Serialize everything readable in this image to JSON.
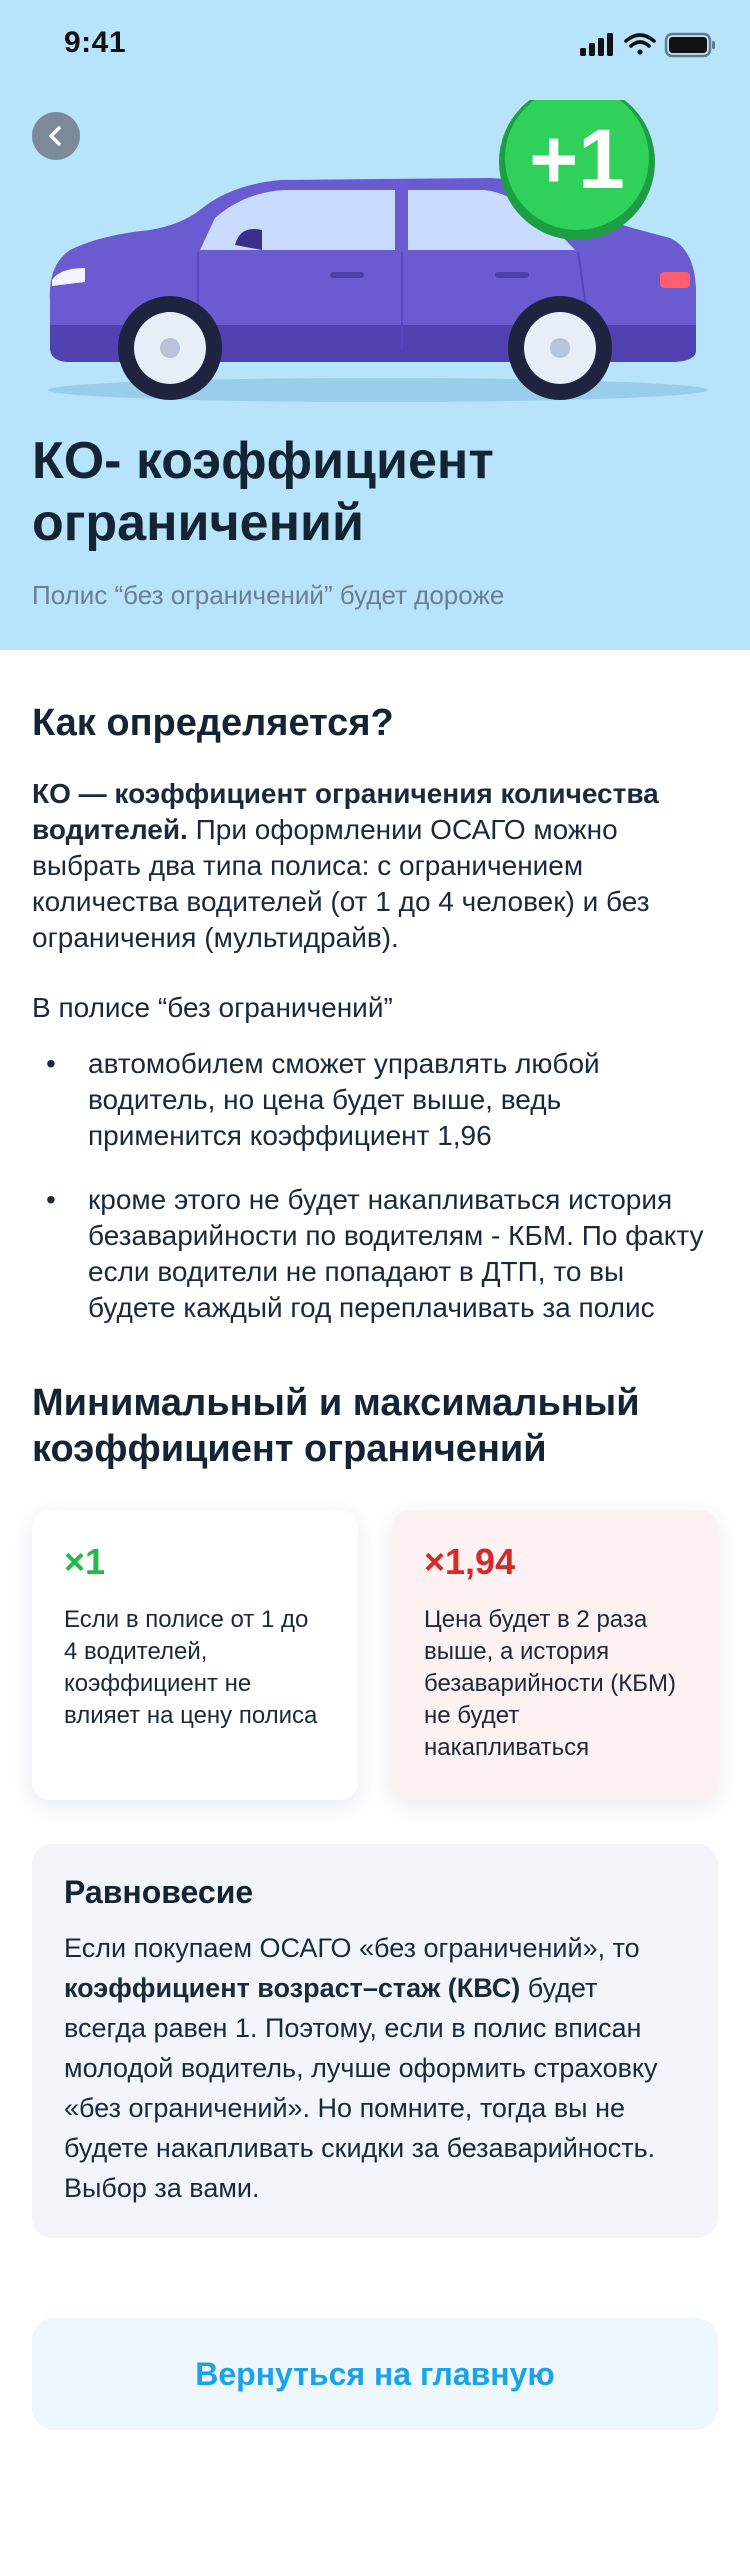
{
  "status_bar": {
    "time": "9:41"
  },
  "hero": {
    "back_icon": "chevron-left-icon",
    "badge_text": "+1",
    "title": "КО- коэффициент ограничений",
    "subtitle": "Полис “без ограничений” будет дороже",
    "colors": {
      "background": "#b7e4fa",
      "car": "#6a5bd0",
      "badge": "#2fd15a"
    }
  },
  "section1": {
    "title": "Как определяется?",
    "intro_bold": "КО — коэффициент ограничения количества водителей.",
    "intro_rest": " При оформлении ОСАГО можно выбрать два типа полиса: с ограничением количества водителей (от 1 до 4 человек) и без ограничения (мультидрайв).",
    "policy_label": "В полисе “без ограничений”",
    "bullets": [
      "автомобилем сможет управлять любой водитель, но цена будет выше, ведь применится коэффициент 1,96",
      "кроме этого не будет накапливаться история безаварийности по водителям - КБМ. По факту если водители не попадают в ДТП, то вы будете каждый год переплачивать за полис"
    ]
  },
  "section2": {
    "title": "Минимальный и максимальный коэффициент ограничений",
    "cards": [
      {
        "value": "×1",
        "text": "Если в полисе от 1 до 4 водителей, коэффициент не влияет на цену полиса",
        "color": "#22b84a"
      },
      {
        "value": "×1,94",
        "text": "Цена будет в 2 раза выше, а история безаварийности (КБМ) не будет накапливаться",
        "color": "#d32a2a"
      }
    ]
  },
  "info": {
    "title": "Равновесие",
    "text_1": "Если покупаем ОСАГО «без ограничений», то ",
    "text_bold": "коэффициент возраст–стаж (КВС)",
    "text_2": " будет всегда равен 1. Поэтому, если в полис вписан молодой водитель, лучше оформить страховку «без ограничений». Но помните, тогда вы не будете накапливать скидки за безаварийность. Выбор за вами."
  },
  "footer": {
    "home_button_label": "Вернуться на главную"
  }
}
